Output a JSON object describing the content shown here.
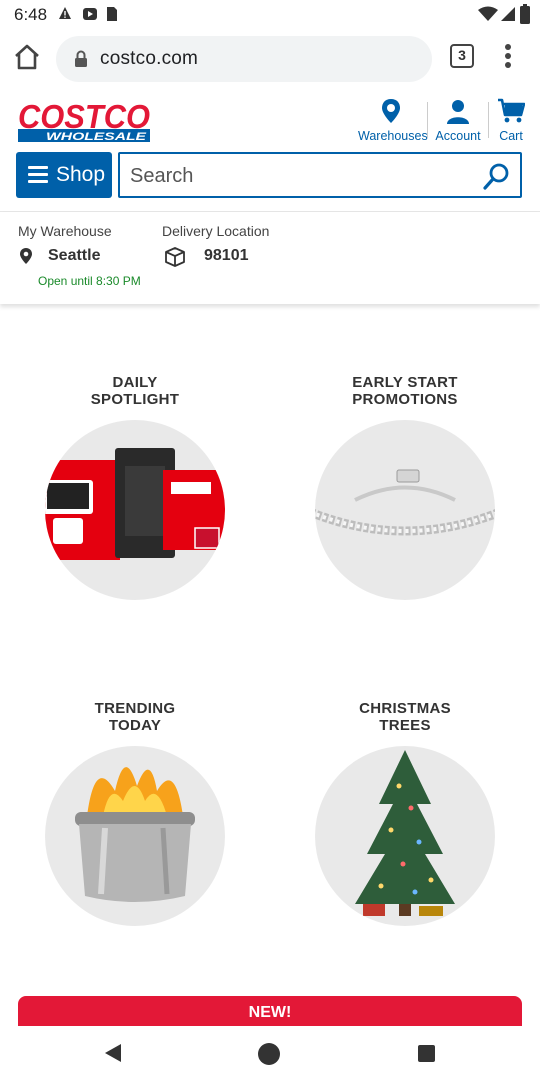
{
  "status_bar": {
    "time": "6:48"
  },
  "browser": {
    "url": "costco.com",
    "tab_count": "3"
  },
  "header": {
    "logo_text_top": "COSTCO",
    "logo_text_bottom": "WHOLESALE",
    "warehouses_label": "Warehouses",
    "account_label": "Account",
    "cart_label": "Cart",
    "shop_label": "Shop",
    "search_placeholder": "Search"
  },
  "warehouse": {
    "my_warehouse_label": "My Warehouse",
    "city": "Seattle",
    "hours": "Open until 8:30 PM",
    "delivery_label": "Delivery Location",
    "zip": "98101"
  },
  "promos": [
    {
      "title": "DAILY\nSPOTLIGHT",
      "image_icon": "nintendo-switch-bundle-image"
    },
    {
      "title": "EARLY START\nPROMOTIONS",
      "image_icon": "diamond-bracelet-image"
    },
    {
      "title": "TRENDING\nTODAY",
      "image_icon": "fire-pit-image"
    },
    {
      "title": "CHRISTMAS\nTREES",
      "image_icon": "christmas-tree-image"
    }
  ],
  "banner": {
    "label": "NEW!"
  },
  "colors": {
    "costco_blue": "#0060a9",
    "costco_red": "#e31837",
    "open_green": "#1a8a2a"
  }
}
